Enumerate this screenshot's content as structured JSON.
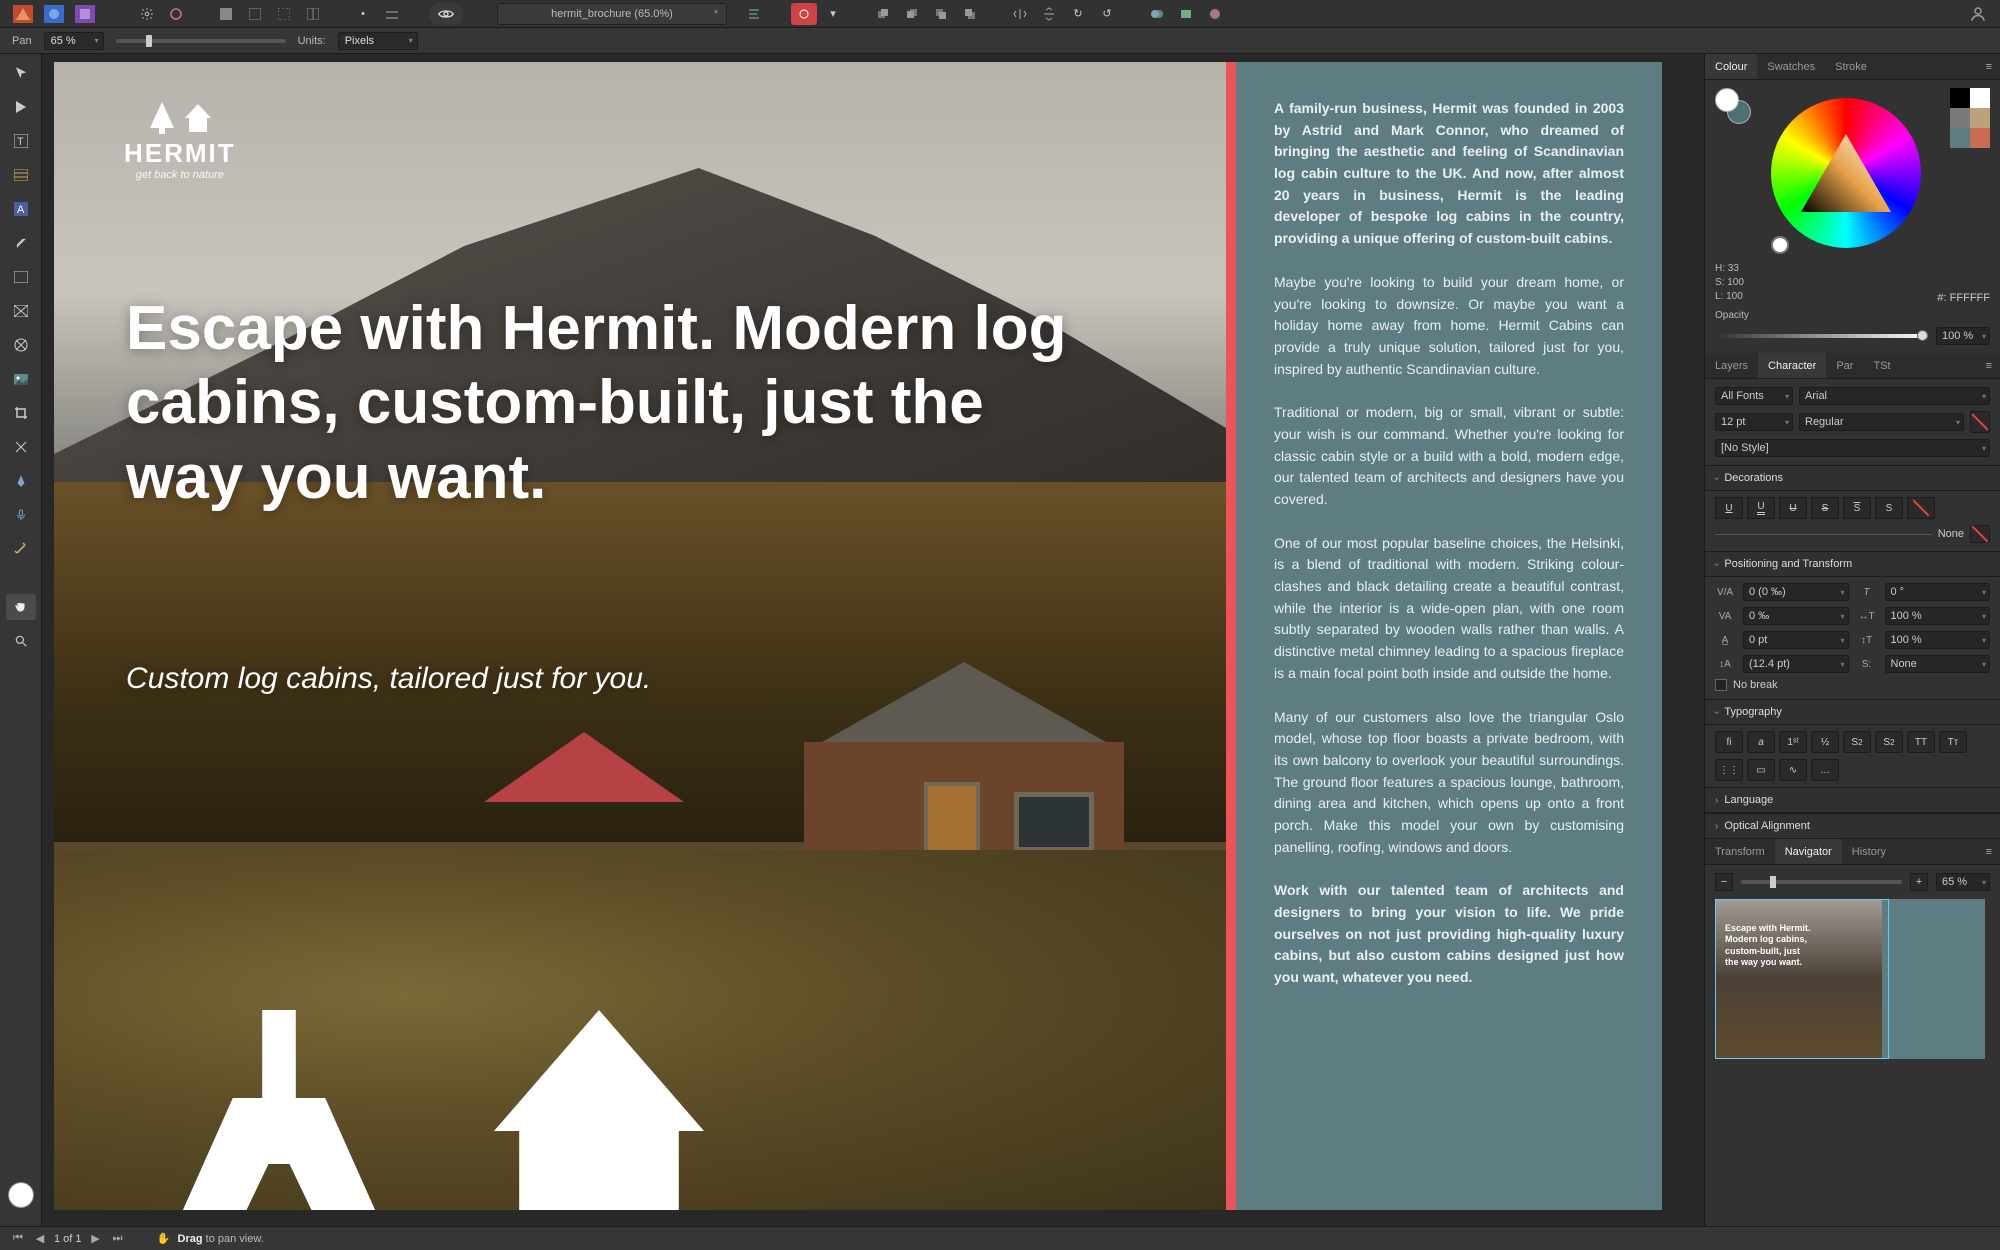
{
  "document": {
    "title": "hermit_brochure (65.0%)",
    "modified": "*"
  },
  "context": {
    "mode_label": "Pan",
    "zoom": "65 %",
    "units_label": "Units:",
    "units_value": "Pixels"
  },
  "artboard": {
    "logo_brand": "HERMIT",
    "logo_tagline": "get back to nature",
    "headline": "Escape with Hermit. Modern log cabins, custom-built, just the way you want.",
    "subhead": "Custom log cabins, tailored just for you.",
    "para_intro": "A family-run business, Hermit was founded in 2003 by Astrid and Mark Connor, who dreamed of bringing the aesthetic and feeling of Scandinavian log cabin culture to the UK. And now, after almost 20 years in business, Hermit is the leading developer of bespoke log cabins in the country, providing a unique offering of custom-built cabins.",
    "para_maybe": "Maybe you're looking to build your dream home, or you're looking to downsize. Or maybe you want a holiday home away from home. Hermit Cabins can provide a truly unique solution, tailored just for you, inspired by authentic Scandinavian culture.",
    "para_trad": "Traditional or modern, big or small, vibrant or subtle: your wish is our command. Whether you're looking for classic cabin style or a build with a bold, modern edge, our talented team of architects and designers have you covered.",
    "para_pop": "One of our most popular baseline choices, the Helsinki, is a blend of traditional with modern. Striking colour-clashes and black detailing create a beautiful contrast, while the interior is a wide-open plan, with one room subtly separated by wooden walls rather than walls. A distinctive metal chimney leading to a spacious fireplace is a main focal point both inside and outside the home.",
    "para_cust": "Many of our customers also love the triangular Oslo model, whose top floor boasts a private bedroom, with its own balcony to overlook your beautiful surroundings. The ground floor features a spacious lounge, bathroom, dining area and kitchen, which opens up onto a front porch. Make this model your own by customising panelling, roofing, windows and doors.",
    "para_cta": "Work with our talented team of architects and designers to bring your vision to life. We pride ourselves on not just providing high-quality luxury cabins, but also custom cabins designed just how you want, whatever you need."
  },
  "colour_panel": {
    "tabs": [
      "Colour",
      "Swatches",
      "Stroke"
    ],
    "hsl": {
      "h": "H: 33",
      "s": "S: 100",
      "l": "L: 100"
    },
    "hex_prefix": "#:",
    "hex": "FFFFFF",
    "opacity_label": "Opacity",
    "opacity_value": "100 %",
    "swatches": [
      "#000000",
      "#ffffff",
      "#7a7a7a",
      "#b9a27c",
      "#5d7d82",
      "#c96b55"
    ]
  },
  "char_panel": {
    "tabs": [
      "Layers",
      "Character",
      "Par",
      "TSt"
    ],
    "font_collection": "All Fonts",
    "font_family": "Arial",
    "font_size": "12 pt",
    "font_weight": "Regular",
    "font_style": "[No Style]",
    "decorations_label": "Decorations",
    "decoration_none": "None",
    "positioning_label": "Positioning and Transform",
    "tracking": "0 (0 ‰)",
    "kerning": "0 ‰",
    "baseline": "0 pt",
    "leading": "(12.4 pt)",
    "skew": "0 °",
    "hscale": "100 %",
    "vscale": "100 %",
    "scale_mode": "None",
    "no_break": "No break",
    "typography_label": "Typography",
    "language_label": "Language",
    "optical_label": "Optical Alignment"
  },
  "navigator_panel": {
    "tabs": [
      "Transform",
      "Navigator",
      "History"
    ],
    "zoom": "65 %",
    "thumb_headline": "Escape with Hermit.\nModern log cabins,\ncustom-built, just\nthe way you want."
  },
  "status": {
    "page": "1 of 1",
    "hint_bold": "Drag",
    "hint_rest": " to pan view."
  }
}
